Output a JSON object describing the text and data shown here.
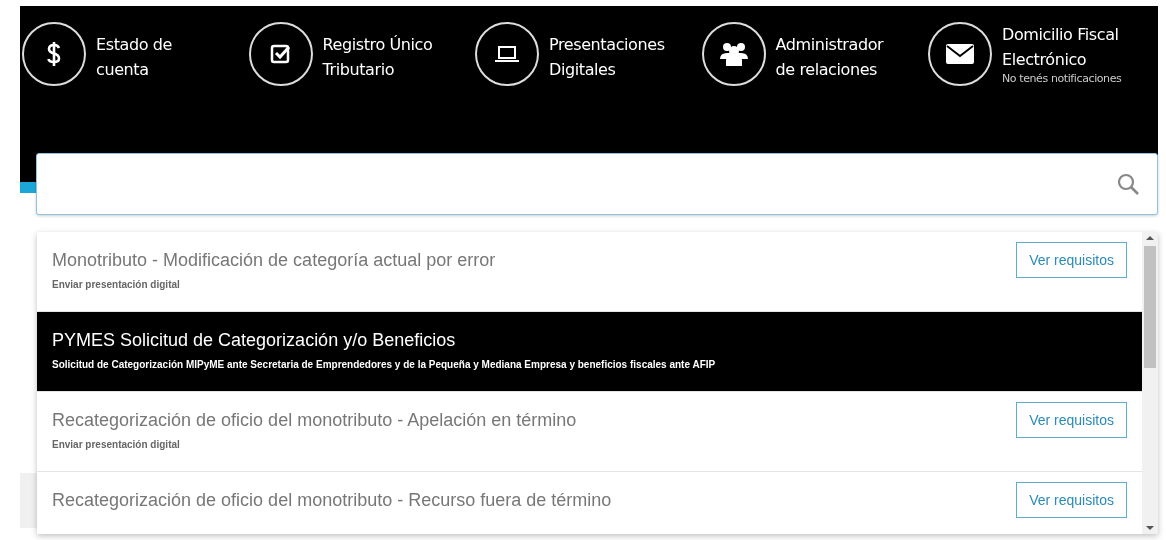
{
  "header": {
    "items": [
      {
        "lines": [
          "Estado de",
          "cuenta"
        ]
      },
      {
        "lines": [
          "Registro Único",
          "Tributario"
        ]
      },
      {
        "lines": [
          "Presentaciones",
          "Digitales"
        ]
      },
      {
        "lines": [
          "Administrador",
          "de relaciones"
        ]
      },
      {
        "lines": [
          "Domicilio Fiscal",
          "Electrónico"
        ],
        "note": "No tenés notificaciones"
      }
    ]
  },
  "search": {
    "kind": "empty"
  },
  "results": [
    {
      "title": "Monotributo - Modificación de categoría actual por error",
      "subtitle": "Enviar presentación digital",
      "button": "Ver requisitos",
      "selected": false
    },
    {
      "title": "PYMES Solicitud de Categorización y/o Beneficios",
      "subtitle": "Solicitud de Categorización MIPyME ante Secretaria de Emprendedores y de la Pequeña y Mediana Empresa y beneficios fiscales ante AFIP",
      "selected": true
    },
    {
      "title": "Recategorización de oficio del monotributo - Apelación en término",
      "subtitle": "Enviar presentación digital",
      "button": "Ver requisitos",
      "selected": false
    },
    {
      "title": "Recategorización de oficio del monotributo - Recurso fuera de término",
      "button": "Ver requisitos",
      "selected": false
    }
  ]
}
